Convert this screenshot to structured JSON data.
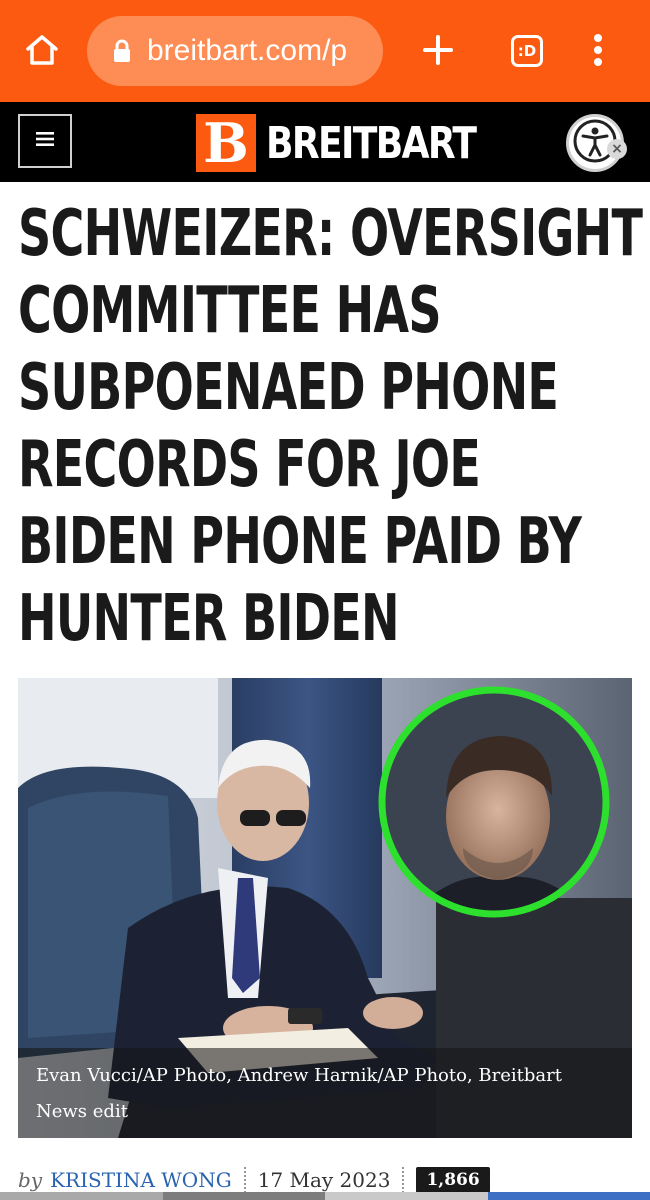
{
  "browser": {
    "url": "breitbart.com/p",
    "tabs_label": ":D",
    "colors": {
      "toolbar": "#fb5a10",
      "url_pill": "#fd8c55"
    },
    "icons": [
      "home-icon",
      "lock-icon",
      "plus-icon",
      "tabs-icon",
      "more-vert-icon"
    ]
  },
  "site": {
    "logo_mark": "B",
    "logo_text": "BREITBART",
    "icons": [
      "hamburger-icon",
      "accessibility-icon",
      "close-icon"
    ],
    "colors": {
      "brand": "#fb5a10",
      "header_bg": "#000000"
    }
  },
  "article": {
    "headline_lines": [
      "SCHWEIZER: OVERSIGHT",
      "COMMITTEE HAS",
      "SUBPOENAED PHONE",
      "RECORDS FOR JOE",
      "BIDEN PHONE PAID BY",
      "HUNTER BIDEN"
    ],
    "photo_caption_line1": "Evan Vucci/AP Photo, Andrew Harnik/AP Photo, Breitbart",
    "photo_caption_line2": "News edit",
    "byline": {
      "by": "by",
      "author": "KRISTINA WONG",
      "date": "17 May 2023",
      "comments": "1,866"
    }
  }
}
